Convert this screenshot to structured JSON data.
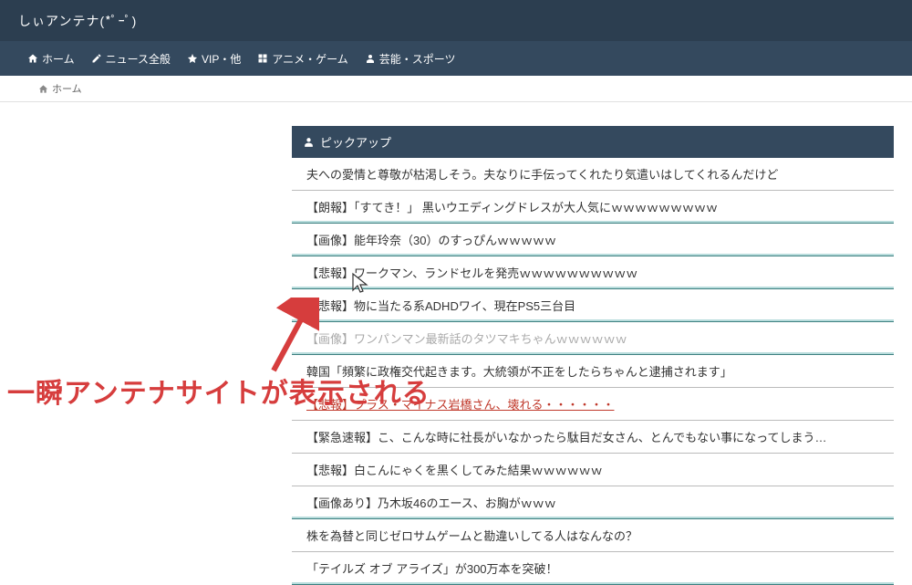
{
  "site_title": "しぃアンテナ(*ﾟｰﾟ)",
  "nav": {
    "home": "ホーム",
    "news": "ニュース全般",
    "vip": "VIP・他",
    "anime": "アニメ・ゲーム",
    "entertainment": "芸能・スポーツ"
  },
  "breadcrumb": {
    "home": "ホーム"
  },
  "pickup": {
    "title": "ピックアップ",
    "items": [
      "夫への愛情と尊敬が枯渇しそう。夫なりに手伝ってくれたり気遣いはしてくれるんだけど",
      "【朗報】「すてき！」 黒いウエディングドレスが大人気にｗｗｗｗｗｗｗｗｗ",
      "【画像】能年玲奈（30）のすっぴんｗｗｗｗｗ",
      "【悲報】ワークマン、ランドセルを発売ｗｗｗｗｗｗｗｗｗｗ",
      "【悲報】物に当たる系ADHDワイ、現在PS5三台目",
      "【画像】ワンパンマン最新話のタツマキちゃんｗｗｗｗｗｗ",
      "韓国「頻繁に政権交代起きます。大統領が不正をしたらちゃんと逮捕されます」",
      "【悲報】プラス・マイナス岩橋さん、壊れる・・・・・・",
      "【緊急速報】こ、こんな時に社長がいなかったら駄目だ女さん、とんでもない事になってしまう…",
      "【悲報】白こんにゃくを黒くしてみた結果ｗｗｗｗｗｗ",
      "【画像あり】乃木坂46のエース、お胸がｗｗｗ",
      "株を為替と同じゼロサムゲームと勘違いしてる人はなんなの？",
      "「テイルズ オブ アライズ」が300万本を突破！"
    ]
  },
  "annotation": "一瞬アンテナサイトが表示される"
}
